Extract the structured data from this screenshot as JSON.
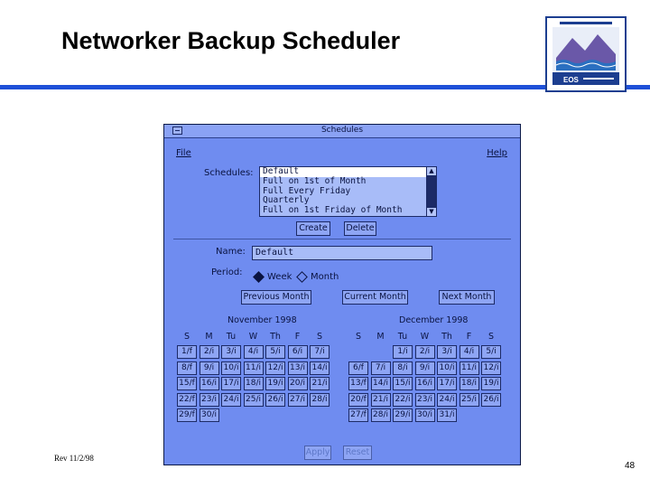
{
  "slide": {
    "title": "Networker Backup Scheduler",
    "footer": "Rev 11/2/98",
    "page_number": "48"
  },
  "window": {
    "title": "Schedules",
    "menu": {
      "file": "File",
      "help": "Help"
    },
    "schedules_label": "Schedules:",
    "schedules": [
      "Default",
      "Full on 1st of Month",
      "Full Every Friday",
      "Quarterly",
      "Full on 1st Friday of Month"
    ],
    "selected_schedule": "Default",
    "create_label": "Create",
    "delete_label": "Delete",
    "name_label": "Name:",
    "name_value": "Default",
    "period_label": "Period:",
    "period_week": "Week",
    "period_month": "Month",
    "period_selected": "Week",
    "prev_month": "Previous Month",
    "current_month": "Current Month",
    "next_month": "Next Month",
    "apply_label": "Apply",
    "reset_label": "Reset"
  },
  "calendars": [
    {
      "title": "November 1998",
      "weekdays": [
        "S",
        "M",
        "Tu",
        "W",
        "Th",
        "F",
        "S"
      ],
      "first_weekday": 0,
      "days": [
        "1/f",
        "2/i",
        "3/i",
        "4/i",
        "5/i",
        "6/i",
        "7/i",
        "8/f",
        "9/i",
        "10/i",
        "11/i",
        "12/i",
        "13/i",
        "14/i",
        "15/f",
        "16/i",
        "17/i",
        "18/i",
        "19/i",
        "20/i",
        "21/i",
        "22/f",
        "23/i",
        "24/i",
        "25/i",
        "26/i",
        "27/i",
        "28/i",
        "29/f",
        "30/i"
      ]
    },
    {
      "title": "December 1998",
      "weekdays": [
        "S",
        "M",
        "Tu",
        "W",
        "Th",
        "F",
        "S"
      ],
      "first_weekday": 2,
      "days": [
        "1/i",
        "2/i",
        "3/i",
        "4/i",
        "5/i",
        "6/f",
        "7/i",
        "8/i",
        "9/i",
        "10/i",
        "11/i",
        "12/i",
        "13/f",
        "14/i",
        "15/i",
        "16/i",
        "17/i",
        "18/i",
        "19/i",
        "20/f",
        "21/i",
        "22/i",
        "23/i",
        "24/i",
        "25/i",
        "26/i",
        "27/f",
        "28/i",
        "29/i",
        "30/i",
        "31/i"
      ]
    }
  ]
}
